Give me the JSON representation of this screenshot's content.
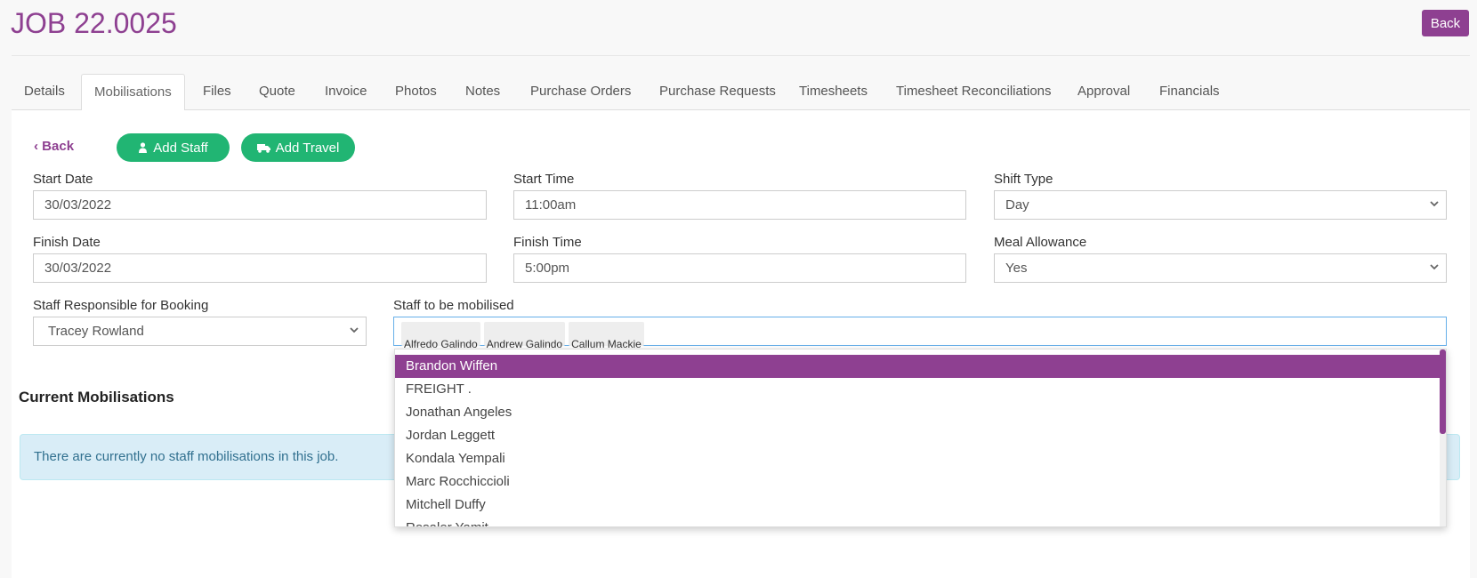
{
  "header": {
    "title": "JOB 22.0025",
    "back_label": "Back"
  },
  "tabs": [
    {
      "label": "Details"
    },
    {
      "label": "Mobilisations",
      "active": true
    },
    {
      "label": "Files"
    },
    {
      "label": "Quote"
    },
    {
      "label": "Invoice"
    },
    {
      "label": "Photos"
    },
    {
      "label": "Notes"
    },
    {
      "label": "Purchase Orders"
    },
    {
      "label": "Purchase Requests"
    },
    {
      "label": "Timesheets"
    },
    {
      "label": "Timesheet Reconciliations"
    },
    {
      "label": "Approval"
    },
    {
      "label": "Financials"
    }
  ],
  "toolbar": {
    "back_label": "Back",
    "add_staff_label": "Add Staff",
    "add_travel_label": "Add Travel"
  },
  "form": {
    "start_date": {
      "label": "Start Date",
      "value": "30/03/2022"
    },
    "start_time": {
      "label": "Start Time",
      "value": "11:00am"
    },
    "shift_type": {
      "label": "Shift Type",
      "value": "Day"
    },
    "finish_date": {
      "label": "Finish Date",
      "value": "30/03/2022"
    },
    "finish_time": {
      "label": "Finish Time",
      "value": "5:00pm"
    },
    "meal_allowance": {
      "label": "Meal Allowance",
      "value": "Yes"
    },
    "staff_responsible": {
      "label": "Staff Responsible for Booking",
      "value": "Tracey Rowland"
    },
    "staff_mobilised": {
      "label": "Staff to be mobilised",
      "selected": [
        "Alfredo Galindo",
        "Andrew Galindo",
        "Callum Mackie"
      ]
    }
  },
  "dropdown": {
    "options": [
      "Brandon Wiffen",
      "FREIGHT .",
      "Jonathan Angeles",
      "Jordan Leggett",
      "Kondala Yempali",
      "Marc Rocchiccioli",
      "Mitchell Duffy",
      "Rosalor Yamit"
    ],
    "highlighted": "Brandon Wiffen"
  },
  "mobilisations": {
    "heading": "Current Mobilisations",
    "empty_message": "There are currently no staff mobilisations in this job."
  },
  "colors": {
    "accent": "#8e4091",
    "success": "#21b573",
    "info_bg": "#d9edf7",
    "info_text": "#31708f"
  }
}
